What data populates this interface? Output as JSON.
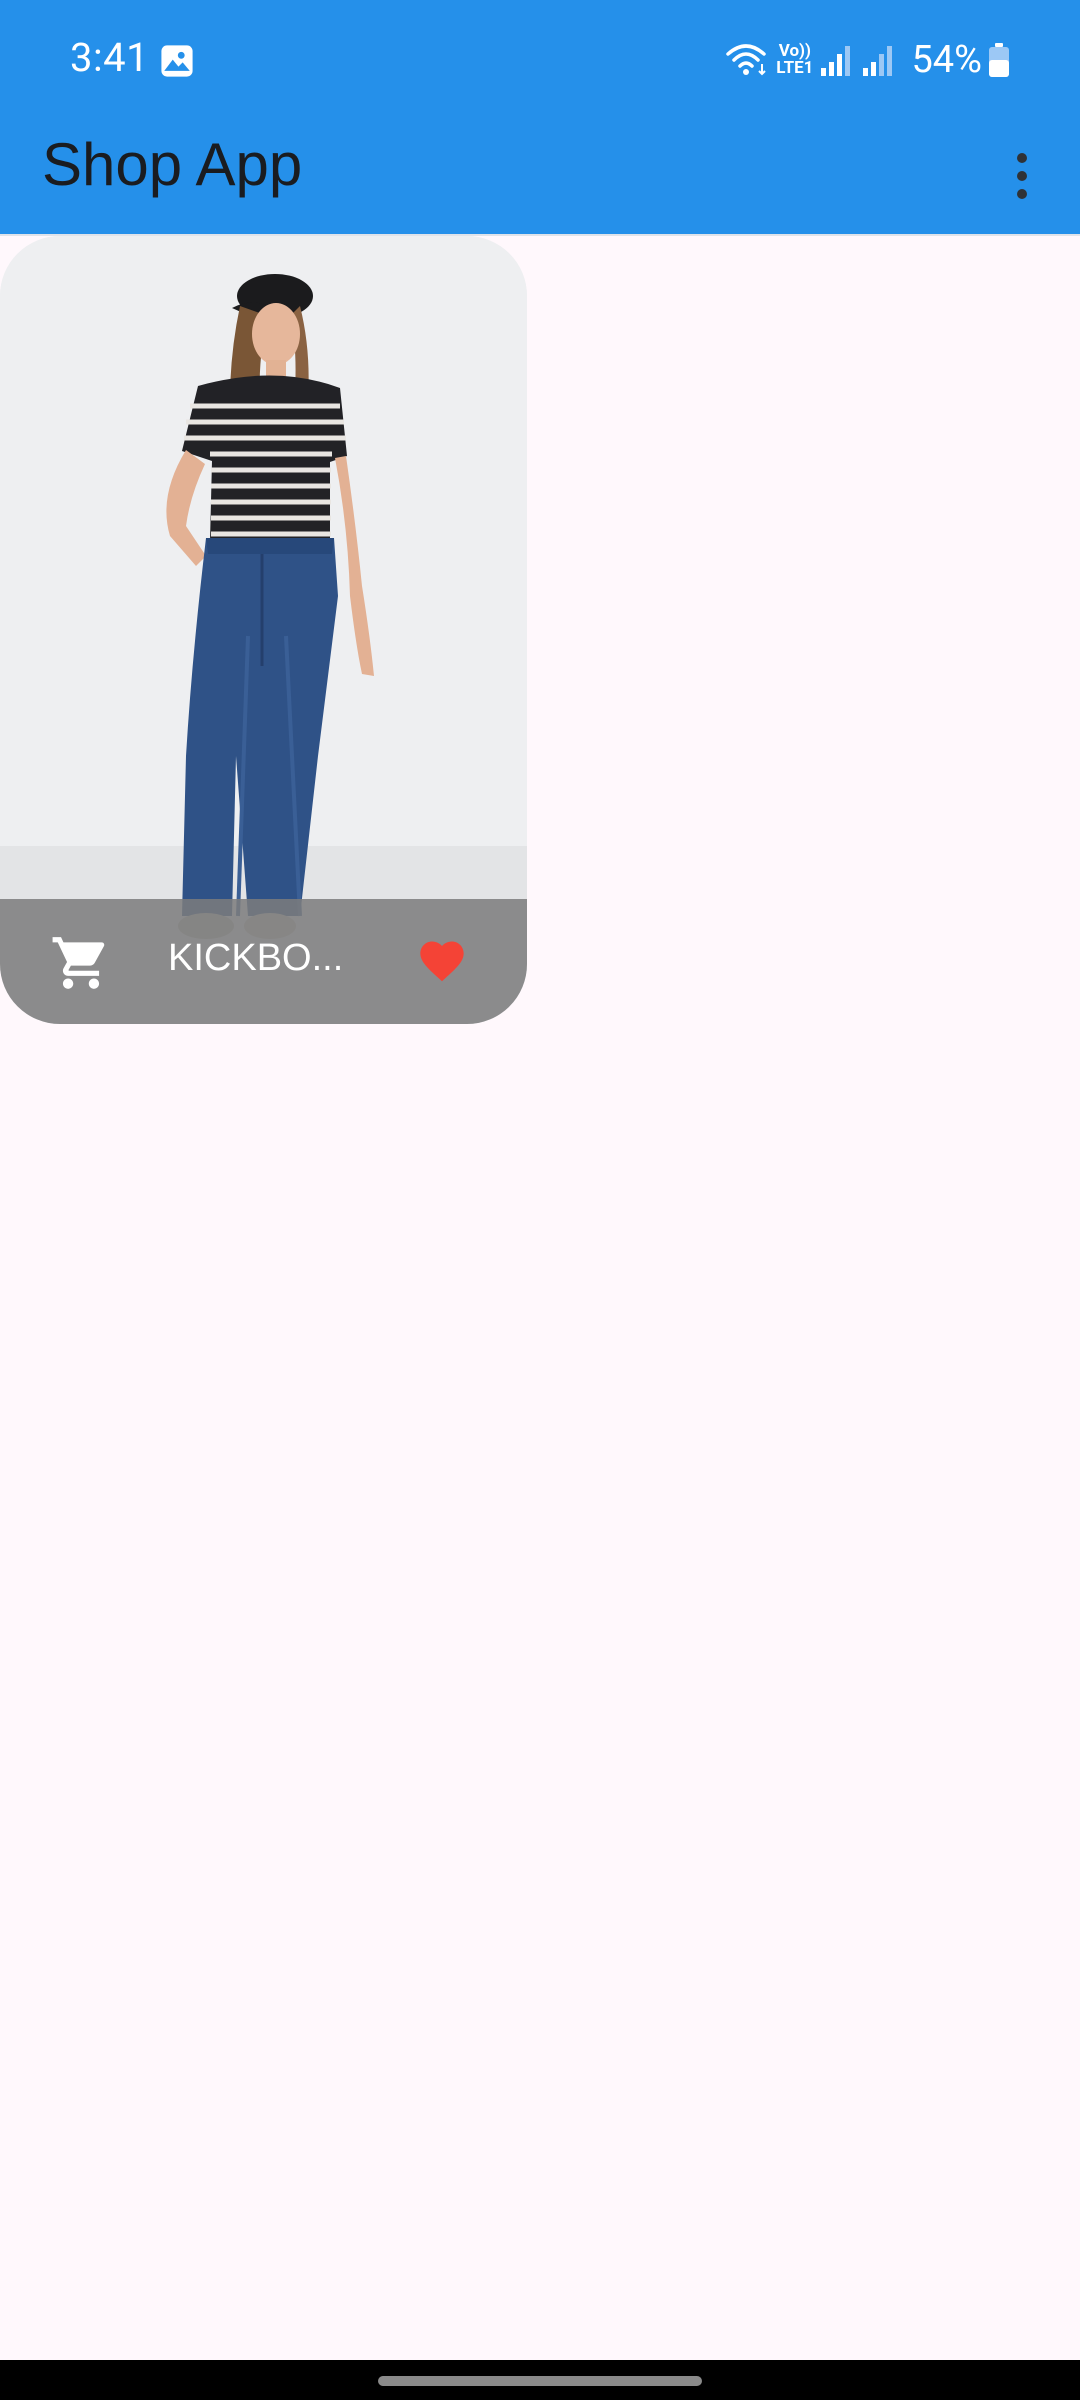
{
  "status_bar": {
    "time": "3:41",
    "network_label_top": "Vo))",
    "network_label_bottom": "LTE1",
    "battery": "54%"
  },
  "app_bar": {
    "title": "Shop App",
    "menu_icon": "more-vert-icon"
  },
  "products": [
    {
      "title": "KICKBO...",
      "cart_icon": "shopping-cart-icon",
      "favorite_icon": "heart-icon",
      "favorite": true
    }
  ],
  "colors": {
    "primary": "#2590ea",
    "background": "#fff8fc",
    "favorite": "#f44336",
    "footer_overlay": "#7d7d7d"
  }
}
